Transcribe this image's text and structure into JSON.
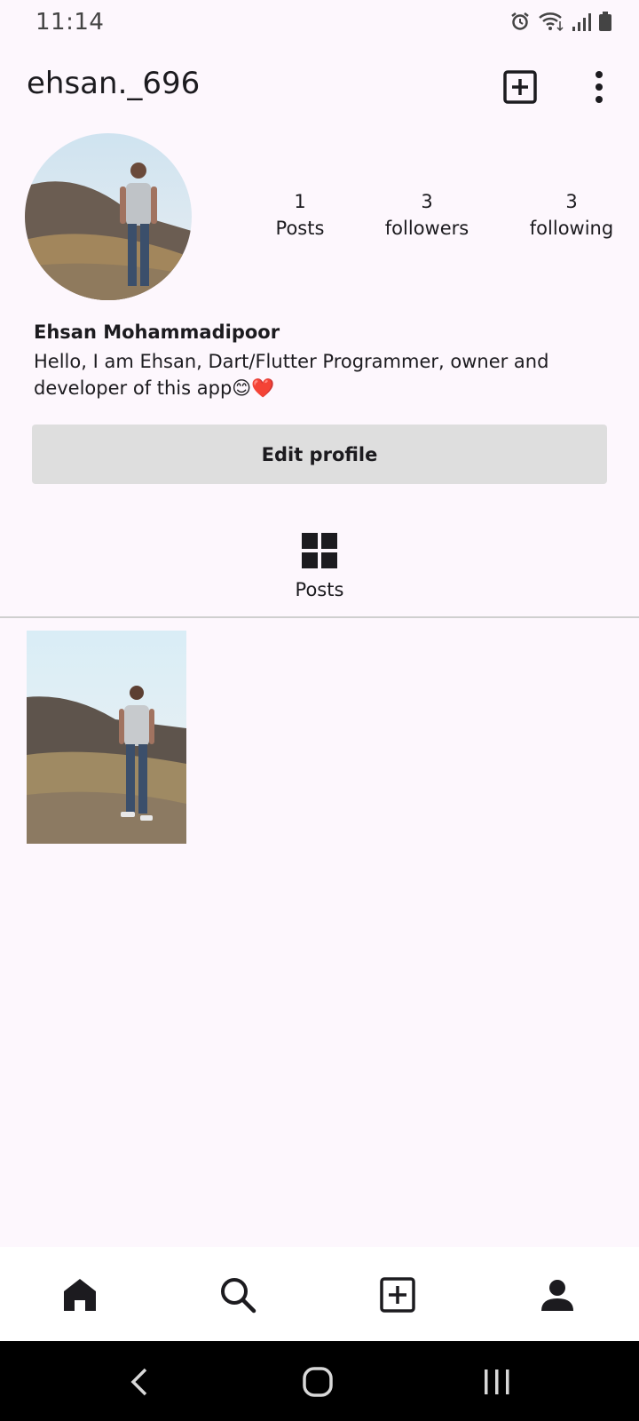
{
  "status_bar": {
    "time": "11:14",
    "icons": [
      "alarm-icon",
      "wifi-icon",
      "signal-icon",
      "battery-icon"
    ]
  },
  "app_bar": {
    "username": "ehsan._696",
    "actions": [
      "add-box-icon",
      "more-vert-icon"
    ]
  },
  "profile": {
    "avatar": "profile-photo",
    "stats": [
      {
        "count": "1",
        "label": "Posts"
      },
      {
        "count": "3",
        "label": "followers"
      },
      {
        "count": "3",
        "label": "following"
      }
    ],
    "full_name": "Ehsan Mohammadipoor",
    "bio": "Hello, I am Ehsan, Dart/Flutter Programmer, owner and developer of this app😊❤️",
    "edit_button": "Edit profile"
  },
  "tabs": {
    "posts_label": "Posts",
    "posts_icon": "grid-icon"
  },
  "posts": [
    {
      "thumbnail": "man-on-hillside-photo"
    }
  ],
  "bottom_nav": {
    "items": [
      "home-icon",
      "search-icon",
      "add-box-icon",
      "person-icon"
    ],
    "active": "person-icon"
  },
  "system_nav": {
    "items": [
      "back-icon",
      "home-circle-icon",
      "recents-icon"
    ]
  },
  "colors": {
    "background": "#fdf7fd",
    "button_bg": "#dedede",
    "text": "#1c1b1f"
  }
}
